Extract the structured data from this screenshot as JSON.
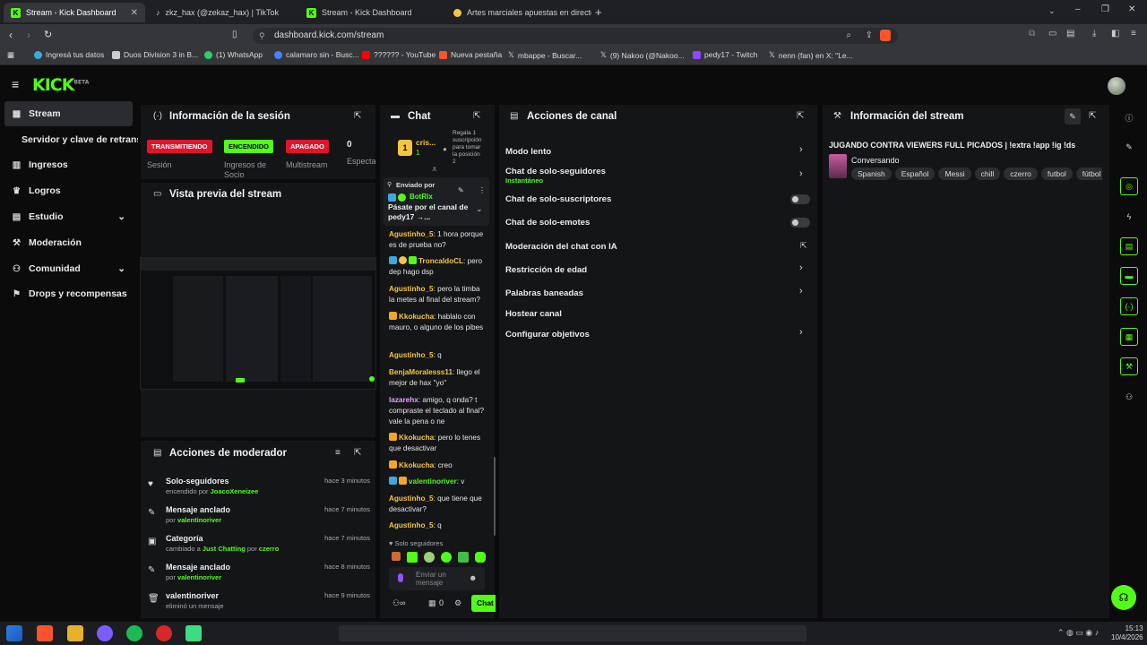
{
  "browser": {
    "tabs": [
      {
        "label": "Stream - Kick Dashboard",
        "active": true
      },
      {
        "label": "zkz_hax (@zekaz_hax) | TikTok"
      },
      {
        "label": "Stream - Kick Dashboard"
      },
      {
        "label": "Artes marciales apuestas en directo"
      }
    ],
    "url": "dashboard.kick.com/stream",
    "bookmarks": [
      "Ingresá tus datos",
      "Duos Division 3 in B...",
      "(1) WhatsApp",
      "calamaro sin - Busc...",
      "?????? - YouTube",
      "Nueva pestaña",
      "mbappe - Buscar...",
      "(9) Nakoo (@Nakoo...",
      "pedy17 - Twitch",
      "nenn (fan) en X: \"Le..."
    ]
  },
  "app": {
    "logo": "KICK",
    "logo_sup": "BETA"
  },
  "sidebar": {
    "items": [
      {
        "label": "Stream",
        "icon": "broadcast-icon"
      },
      {
        "label": "Servidor y clave de retransmisión"
      },
      {
        "label": "Ingresos",
        "icon": "chart-icon"
      },
      {
        "label": "Logros",
        "icon": "trophy-icon"
      },
      {
        "label": "Estudio",
        "icon": "grid-icon"
      },
      {
        "label": "Moderación",
        "icon": "wrench-icon"
      },
      {
        "label": "Comunidad",
        "icon": "people-icon"
      },
      {
        "label": "Drops y recompensas",
        "icon": "gift-icon"
      }
    ]
  },
  "session": {
    "title": "Información de la sesión",
    "badges": [
      {
        "text": "TRANSMITIENDO",
        "label": "Sesión",
        "color": "#e0142a"
      },
      {
        "text": "ENCENDIDO",
        "label": "Ingresos de Socio",
        "color": "#53fc18"
      },
      {
        "text": "APAGADO",
        "label": "Multistream",
        "color": "#e0142a"
      }
    ],
    "viewers": "0",
    "viewers_label": "Espectadores"
  },
  "preview": {
    "title": "Vista previa del stream"
  },
  "modactions": {
    "title": "Acciones de moderador",
    "items": [
      {
        "title": "Solo-seguidores",
        "sub_a": "encendido por ",
        "user": "JoacoXeneizee",
        "time": "hace 3 minutos",
        "icon": "heart-icon"
      },
      {
        "title": "Mensaje anclado",
        "sub_a": "por ",
        "user": "valentinoriver",
        "time": "hace 7 minutos",
        "icon": "pin-icon"
      },
      {
        "title": "Categoría",
        "sub_a": "cambiado a ",
        "user": "Just Chatting",
        "sub_b": " por ",
        "user2": "czerro",
        "time": "hace 7 minutos",
        "icon": "calendar-icon"
      },
      {
        "title": "Mensaje anclado",
        "sub_a": "por ",
        "user": "valentinoriver",
        "time": "hace 8 minutos",
        "icon": "pin-icon"
      },
      {
        "title": "valentinoriver",
        "sub_a": "eliminó un mensaje",
        "user": "",
        "time": "hace 9 minutos",
        "icon": "trash-icon"
      }
    ]
  },
  "chat": {
    "title": "Chat",
    "top_user": "cris...",
    "top_count": "1",
    "top_promo": "Regala 1 suscripción para tomar la posición 2",
    "pinned_by": "Enviado por",
    "pinned_user": "BotRix",
    "pinned_text": "Pásate por el canal de pedy17 →...",
    "messages": [
      {
        "user": "Agustinho_5",
        "color": "#f5c542",
        "text": "1 hora porque es de prueba no?"
      },
      {
        "user": "TroncaldoCL",
        "color": "#f5c542",
        "text": "pero dep hago dsp"
      },
      {
        "user": "Agustinho_5",
        "color": "#f5c542",
        "text": "pero la timba la metes al final del stream?"
      },
      {
        "user": "Kkokucha",
        "color": "#f5c542",
        "text": "hablalo con mauro, o alguno de los pibes"
      },
      {
        "user": "Agustinho_5",
        "color": "#f5c542",
        "text": "q"
      },
      {
        "user": "BenjaMoralesss11",
        "color": "#f5c542",
        "text": "llego el mejor de hax \"yo\""
      },
      {
        "user": "lazarehx",
        "color": "#e7a1ff",
        "text": "amigo, q onda? t compraste el teclado al final? vale la pena o ne"
      },
      {
        "user": "Kkokucha",
        "color": "#f5c542",
        "text": "pero lo tenes que desactivar"
      },
      {
        "user": "Kkokucha",
        "color": "#f5c542",
        "text": "creo"
      },
      {
        "user": "valentinoriver",
        "color": "#53fc18",
        "text": "v"
      },
      {
        "user": "Agustinho_5",
        "color": "#f5c542",
        "text": "que tiene que desactivar?"
      },
      {
        "user": "Agustinho_5",
        "color": "#f5c542",
        "text": "q"
      }
    ],
    "mode": "Solo seguidores",
    "placeholder": "Enviar un mensaje",
    "count": "0",
    "send": "Chat"
  },
  "channel": {
    "title": "Acciones de canal",
    "items": [
      {
        "label": "Modo lento",
        "type": "arrow"
      },
      {
        "label": "Chat de solo-seguidores",
        "sub": "Instantáneo",
        "type": "arrow"
      },
      {
        "label": "Chat de solo-suscriptores",
        "type": "toggle"
      },
      {
        "label": "Chat de solo-emotes",
        "type": "toggle"
      },
      {
        "label": "Moderación del chat con IA",
        "type": "external"
      },
      {
        "label": "Restricción de edad",
        "type": "arrow"
      },
      {
        "label": "Palabras baneadas",
        "type": "arrow"
      },
      {
        "label": "Hostear canal",
        "type": "none"
      },
      {
        "label": "Configurar objetivos",
        "type": "arrow"
      }
    ]
  },
  "streaminfo": {
    "title": "Información del stream",
    "stream_title": "JUGANDO CONTRA VIEWERS FULL PICADOS | !extra !app !ig !ds",
    "category": "Conversando",
    "tags": [
      "Spanish",
      "Español",
      "Messi",
      "chill",
      "czerro",
      "futbol",
      "fútbol"
    ]
  },
  "taskbar": {
    "time": "15:13",
    "date": "10/4/2026"
  },
  "colors": {
    "accent": "#53fc18",
    "live": "#e0142a"
  }
}
